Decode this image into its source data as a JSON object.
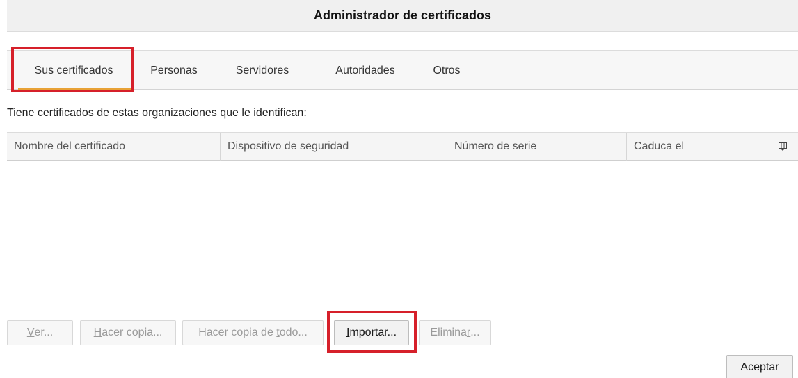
{
  "dialog": {
    "title": "Administrador de certificados"
  },
  "tabs": [
    {
      "label": "Sus certificados",
      "active": true
    },
    {
      "label": "Personas"
    },
    {
      "label": "Servidores"
    },
    {
      "label": "Autoridades"
    },
    {
      "label": "Otros"
    }
  ],
  "intro_text": "Tiene certificados de estas organizaciones que le identifican:",
  "table": {
    "columns": [
      "Nombre del certificado",
      "Dispositivo de seguridad",
      "Número de serie",
      "Caduca el"
    ],
    "rows": [],
    "column_picker_icon": "column-picker-icon"
  },
  "buttons": {
    "view": {
      "pre": "",
      "u": "V",
      "post": "er..."
    },
    "backup": {
      "pre": "",
      "u": "H",
      "post": "acer copia..."
    },
    "backup_all": {
      "pre": "Hacer copia de ",
      "u": "t",
      "post": "odo..."
    },
    "import": {
      "pre": "",
      "u": "I",
      "post": "mportar..."
    },
    "delete": {
      "pre": "Elimina",
      "u": "r",
      "post": "..."
    },
    "accept": "Aceptar"
  },
  "colors": {
    "active_tab_indicator": "#e8a236",
    "highlight": "#d6202a"
  }
}
